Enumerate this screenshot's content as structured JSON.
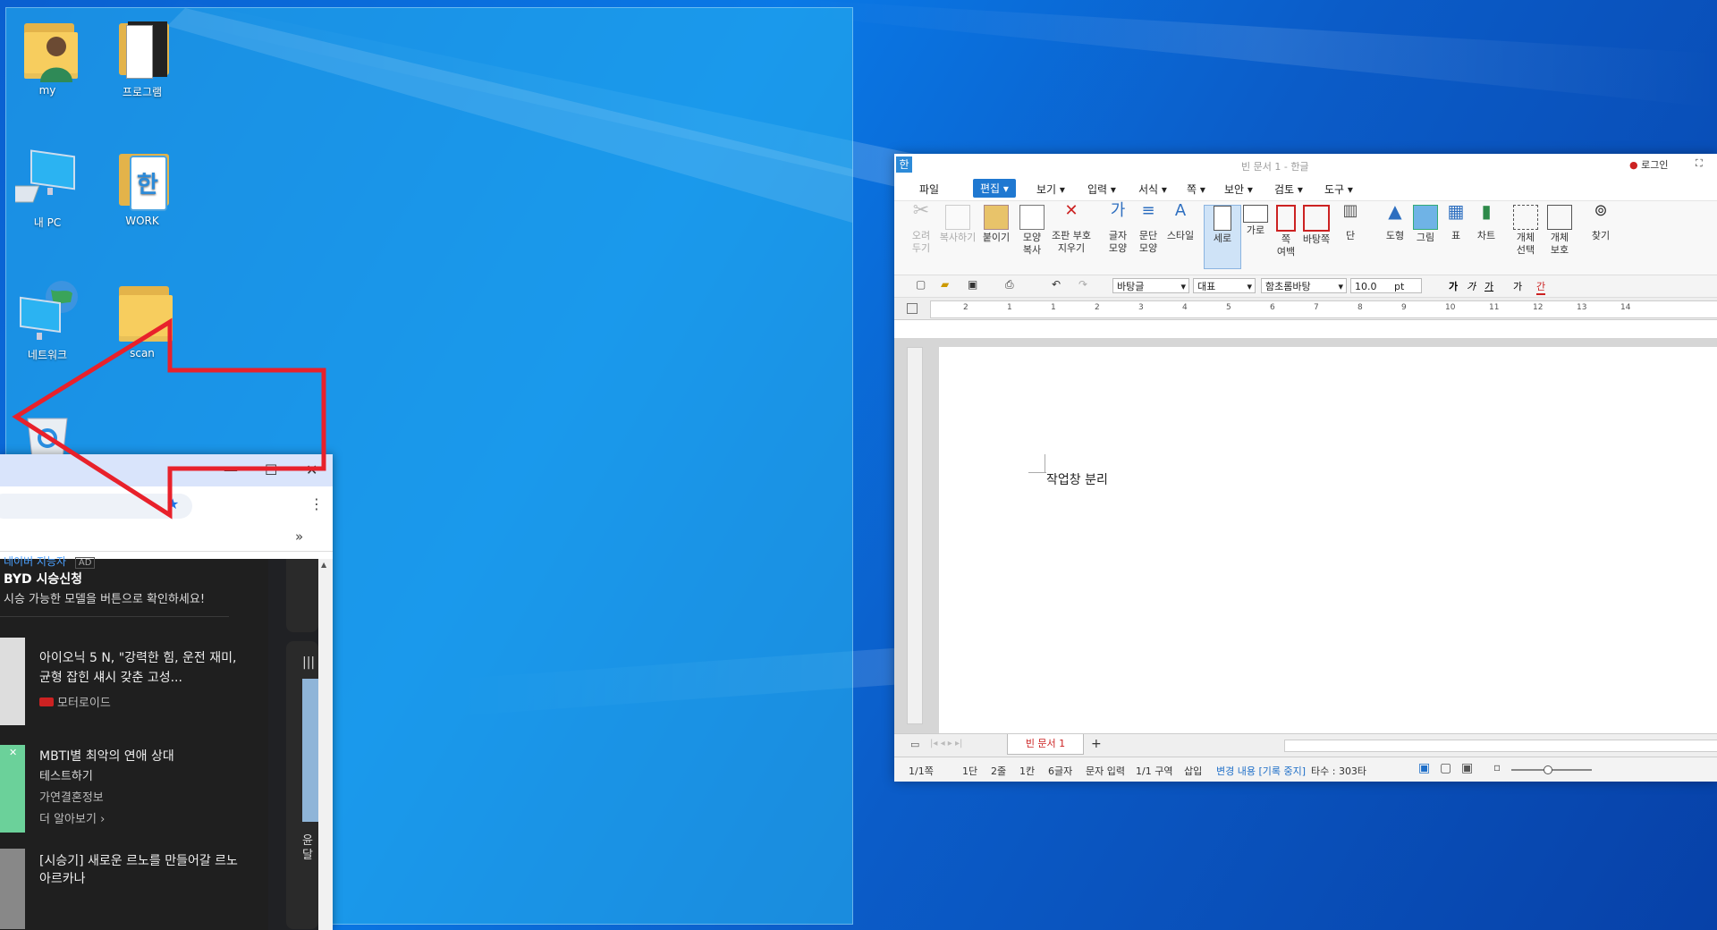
{
  "desktop": {
    "icons": [
      {
        "label": "my",
        "icon": "user-folder-icon"
      },
      {
        "label": "프로그램",
        "icon": "folder-icon"
      },
      {
        "label": "내 PC",
        "icon": "computer-icon"
      },
      {
        "label": "WORK",
        "icon": "hangul-folder-icon"
      },
      {
        "label": "네트워크",
        "icon": "network-icon"
      },
      {
        "label": "scan",
        "icon": "folder-icon"
      },
      {
        "label": "",
        "icon": "recycle-bin-icon"
      }
    ],
    "colors": {
      "wallpaper": "#0a6fd8",
      "snap_preview": "#3bb8f0",
      "arrow": "#e8212b"
    }
  },
  "browser": {
    "ad_source": "네이버 지능자",
    "ad_badge": "AD",
    "ad_title": "BYD 시승신청",
    "ad_desc": "시승 가능한 모델을 버튼으로 확인하세요!",
    "feed": [
      {
        "title": "아이오닉 5 N, \"강력한 힘, 운전 재미, 균형 잡힌 섀시 갖춘 고성...",
        "source": "모터로이드"
      },
      {
        "title": "MBTI별 최악의 연애 상대",
        "subtitle": "테스트하기",
        "source": "가연결혼정보",
        "more": "더 알아보기"
      },
      {
        "title": "[시승기] 새로운 르노를 만들어갈 르노 아르카나",
        "source": ""
      }
    ],
    "side_text": "윤 달"
  },
  "hwp": {
    "title": "빈 문서 1 - 한글",
    "login": "로그인",
    "menu": [
      "파일",
      "편집",
      "보기",
      "입력",
      "서식",
      "쪽",
      "보안",
      "검토",
      "도구"
    ],
    "ribbon": [
      {
        "label": "오려\n두기",
        "icon": "scissors-icon",
        "disabled": true
      },
      {
        "label": "복사하기",
        "icon": "copy-icon",
        "disabled": true
      },
      {
        "label": "붙이기",
        "icon": "paste-icon"
      },
      {
        "label": "모양\n복사",
        "icon": "format-painter-icon"
      },
      {
        "label": "조판 부호\n지우기",
        "icon": "clear-codes-icon"
      },
      {
        "label": "글자\n모양",
        "icon": "char-shape-icon"
      },
      {
        "label": "문단\n모양",
        "icon": "para-shape-icon"
      },
      {
        "label": "스타일",
        "icon": "style-icon"
      },
      {
        "label": "세로",
        "icon": "portrait-icon",
        "active": true
      },
      {
        "label": "가로",
        "icon": "landscape-icon"
      },
      {
        "label": "쪽\n여백",
        "icon": "margins-icon"
      },
      {
        "label": "바탕쪽",
        "icon": "master-page-icon"
      },
      {
        "label": "단",
        "icon": "columns-icon"
      },
      {
        "label": "도형",
        "icon": "shape-icon"
      },
      {
        "label": "그림",
        "icon": "picture-icon"
      },
      {
        "label": "표",
        "icon": "table-icon"
      },
      {
        "label": "차트",
        "icon": "chart-icon"
      },
      {
        "label": "개체\n선택",
        "icon": "select-object-icon"
      },
      {
        "label": "개체\n보호",
        "icon": "protect-object-icon"
      },
      {
        "label": "찾기",
        "icon": "binoculars-icon"
      }
    ],
    "format_bar": {
      "style": "바탕글",
      "lang": "대표",
      "font": "함초롬바탕",
      "size": "10.0",
      "unit": "pt",
      "bold": "가",
      "italic": "가",
      "underline": "가",
      "strike": "가",
      "color": "간"
    },
    "ruler_numbers": [
      "2",
      "1",
      "1",
      "2",
      "3",
      "4",
      "5",
      "6",
      "7",
      "8",
      "9",
      "10",
      "11",
      "12",
      "13",
      "14"
    ],
    "document_text": "작업창 분리",
    "tab_name": "빈 문서 1",
    "status": [
      "1/1쪽",
      "1단",
      "2줄",
      "1칸",
      "6글자",
      "문자 입력",
      "1/1 구역",
      "삽입",
      "변경 내용 [기록 중지]",
      "타수 : 303타"
    ]
  }
}
